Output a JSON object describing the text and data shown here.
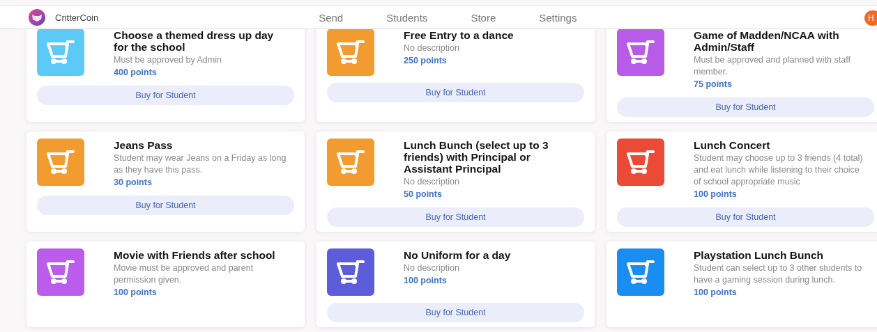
{
  "header": {
    "brand": "CritterCoin",
    "nav": [
      "Send",
      "Students",
      "Store",
      "Settings"
    ],
    "avatar": "H"
  },
  "items": [
    {
      "title": "Choose a themed dress up day for the school",
      "description": "Must be approved by Admin",
      "points": "400 points",
      "color": "#5ccaf6",
      "button": "Buy for Student"
    },
    {
      "title": "Free Entry to a dance",
      "description": "No description",
      "points": "250 points",
      "color": "#f29b30",
      "button": "Buy for Student"
    },
    {
      "title": "Game of Madden/NCAA with Admin/Staff",
      "description": "Must be approved and planned with staff member.",
      "points": "75 points",
      "color": "#b95be9",
      "button": "Buy for Student"
    },
    {
      "title": "Jeans Pass",
      "description": "Student may wear Jeans on a Friday as long as they have this pass.",
      "points": "30 points",
      "color": "#f29b30",
      "button": "Buy for Student"
    },
    {
      "title": "Lunch Bunch (select up to 3 friends) with Principal or Assistant Principal",
      "description": "No description",
      "points": "50 points",
      "color": "#f29b30",
      "button": "Buy for Student"
    },
    {
      "title": "Lunch Concert",
      "description": "Student may choose up to 3 friends (4 total) and eat lunch while listening to their choice of school appropriate music",
      "points": "100 points",
      "color": "#ea4a36",
      "button": "Buy for Student"
    },
    {
      "title": "Movie with Friends after school",
      "description": "Movie must be approved and parent permission given.",
      "points": "100 points",
      "color": "#bb5cec"
    },
    {
      "title": "No Uniform for a day",
      "description": "No description",
      "points": "100 points",
      "color": "#5d5ddc",
      "button": "Buy for Student"
    },
    {
      "title": "Playstation Lunch Bunch",
      "description": "Student can select up to 3 other students to have a gaming session during lunch.",
      "points": "100 points",
      "color": "#1a8df2"
    }
  ]
}
